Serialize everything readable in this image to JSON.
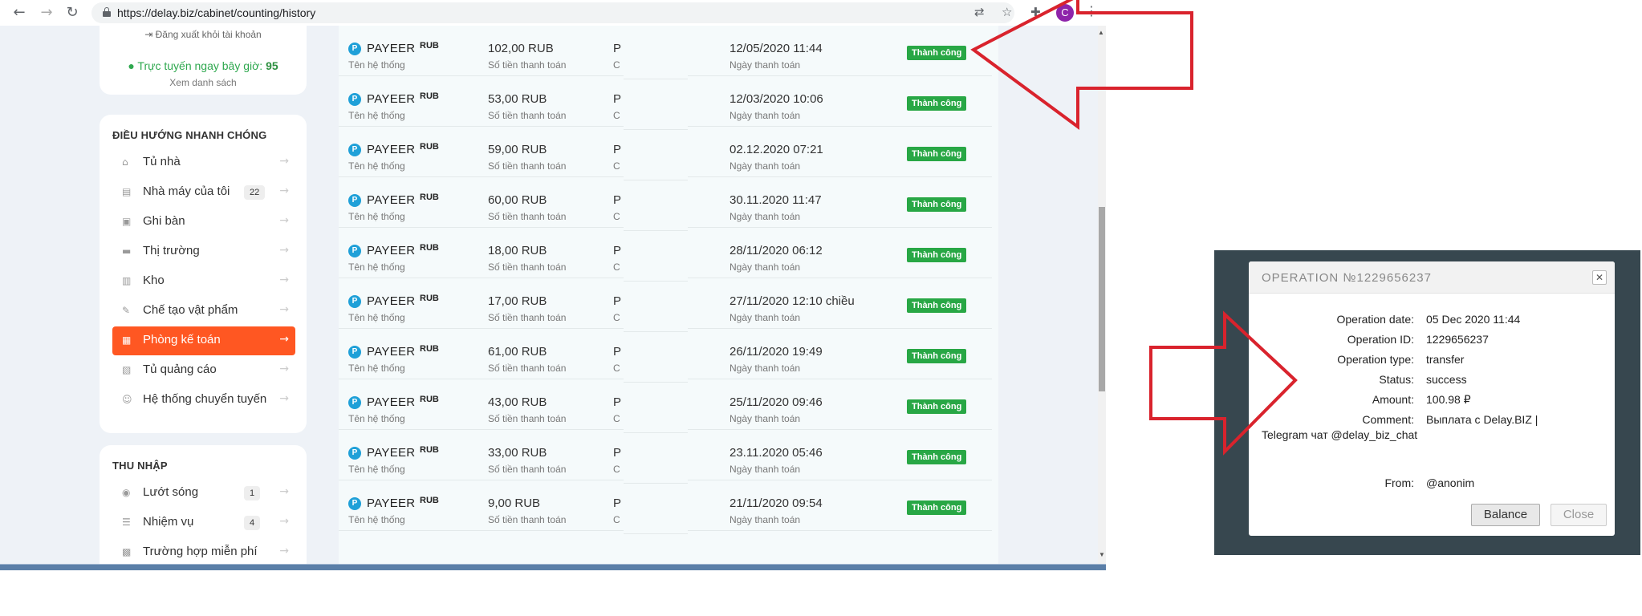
{
  "browser": {
    "url": "https://delay.biz/cabinet/counting/history",
    "profile_initial": "C"
  },
  "sidebar": {
    "logout": "⇥ Đăng xuất khỏi tài khoản",
    "online_label": "Trực tuyến ngay bây giờ:",
    "online_count": "95",
    "view_list": "Xem danh sách",
    "nav_heading": "ĐIỀU HƯỚNG NHANH CHÓNG",
    "nav_items": [
      {
        "label": "Tủ nhà",
        "badge": ""
      },
      {
        "label": "Nhà máy của tôi",
        "badge": "22"
      },
      {
        "label": "Ghi bàn",
        "badge": ""
      },
      {
        "label": "Thị trường",
        "badge": ""
      },
      {
        "label": "Kho",
        "badge": ""
      },
      {
        "label": "Chế tạo vật phẩm",
        "badge": ""
      },
      {
        "label": "Phòng kế toán",
        "badge": ""
      },
      {
        "label": "Tủ quảng cáo",
        "badge": ""
      },
      {
        "label": "Hệ thống chuyển tuyến",
        "badge": ""
      }
    ],
    "income_heading": "THU NHẬP",
    "income_items": [
      {
        "label": "Lướt sóng",
        "badge": "1"
      },
      {
        "label": "Nhiệm vụ",
        "badge": "4"
      },
      {
        "label": "Trường hợp miễn phí",
        "badge": ""
      }
    ]
  },
  "table": {
    "system_sub": "Tên hệ thống",
    "amount_sub": "Số tiền thanh toán",
    "date_sub": "Ngày thanh toán",
    "rows": [
      {
        "system": "PAYEER",
        "currency": "RUB",
        "amount": "102,00 RUB",
        "date": "12/05/2020 11:44",
        "status": "Thành công"
      },
      {
        "system": "PAYEER",
        "currency": "RUB",
        "amount": "53,00 RUB",
        "date": "12/03/2020 10:06",
        "status": "Thành công"
      },
      {
        "system": "PAYEER",
        "currency": "RUB",
        "amount": "59,00 RUB",
        "date": "02.12.2020 07:21",
        "status": "Thành công"
      },
      {
        "system": "PAYEER",
        "currency": "RUB",
        "amount": "60,00 RUB",
        "date": "30.11.2020 11:47",
        "status": "Thành công"
      },
      {
        "system": "PAYEER",
        "currency": "RUB",
        "amount": "18,00 RUB",
        "date": "28/11/2020 06:12",
        "status": "Thành công"
      },
      {
        "system": "PAYEER",
        "currency": "RUB",
        "amount": "17,00 RUB",
        "date": "27/11/2020 12:10 chiều",
        "status": "Thành công"
      },
      {
        "system": "PAYEER",
        "currency": "RUB",
        "amount": "61,00 RUB",
        "date": "26/11/2020 19:49",
        "status": "Thành công"
      },
      {
        "system": "PAYEER",
        "currency": "RUB",
        "amount": "43,00 RUB",
        "date": "25/11/2020 09:46",
        "status": "Thành công"
      },
      {
        "system": "PAYEER",
        "currency": "RUB",
        "amount": "33,00 RUB",
        "date": "23.11.2020 05:46",
        "status": "Thành công"
      },
      {
        "system": "PAYEER",
        "currency": "RUB",
        "amount": "9,00 RUB",
        "date": "21/11/2020 09:54",
        "status": "Thành công"
      }
    ]
  },
  "modal": {
    "title": "OPERATION №1229656237",
    "fields": [
      {
        "label": "Operation date:",
        "value": "05 Dec 2020 11:44"
      },
      {
        "label": "Operation ID:",
        "value": "1229656237"
      },
      {
        "label": "Operation type:",
        "value": "transfer"
      },
      {
        "label": "Status:",
        "value": "success"
      },
      {
        "label": "Amount:",
        "value": "100.98 ₽"
      },
      {
        "label": "Comment:",
        "value": "Выплата с Delay.BIZ |"
      }
    ],
    "comment_line2": "Telegram чат @delay_biz_chat",
    "from_label": "From:",
    "from_value": "@anonim",
    "balance_button": "Balance",
    "close_button": "Close"
  },
  "colors": {
    "accent": "#ff5722",
    "success": "#28a745",
    "annotation": "#d9232d",
    "payeer": "#1fa0d8"
  }
}
